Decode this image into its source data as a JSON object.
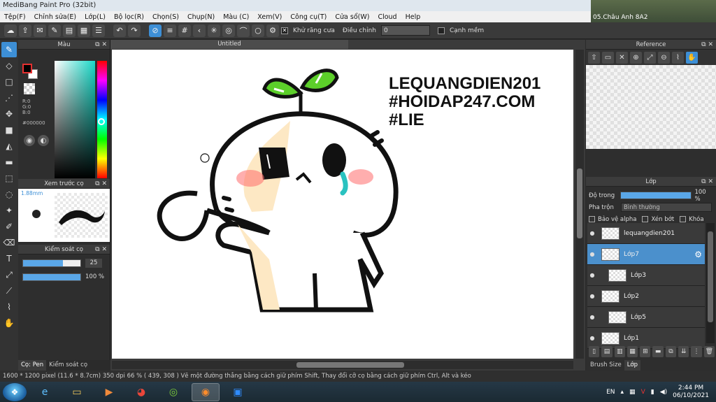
{
  "window": {
    "title": "MediBang Paint Pro (32bit)"
  },
  "desktop": {
    "label": "05.Châu Anh 8A2"
  },
  "menu": [
    {
      "label": "Tệp(F)"
    },
    {
      "label": "Chỉnh sửa(E)"
    },
    {
      "label": "Lớp(L)"
    },
    {
      "label": "Bộ lọc(R)"
    },
    {
      "label": "Chọn(S)"
    },
    {
      "label": "Chụp(N)"
    },
    {
      "label": "Màu (C)"
    },
    {
      "label": "Xem(V)"
    },
    {
      "label": "Công cụ(T)"
    },
    {
      "label": "Cửa sổ(W)"
    },
    {
      "label": "Cloud"
    },
    {
      "label": "Help"
    }
  ],
  "toolbar": {
    "antialias_label": "Khử răng cưa",
    "adjust_label": "Điều chỉnh",
    "adjust_value": "0",
    "edge_label": "Cạnh mềm"
  },
  "color_panel": {
    "title": "Màu",
    "r": "R:0",
    "g": "G:0",
    "b": "B:0",
    "hex": "#000000"
  },
  "brush_preview": {
    "title": "Xem trước cọ",
    "size": "1.88mm"
  },
  "brush_control": {
    "title": "Kiểm soát cọ",
    "size_value": "25",
    "size_fraction": 0.7,
    "opacity_value": "100 %",
    "opacity_fraction": 1.0
  },
  "left_tabs": [
    {
      "label": "Cọ: Pen"
    },
    {
      "label": "Kiểm soát cọ"
    }
  ],
  "canvas": {
    "tab_title": "Untitled",
    "text_line1": "LEQUANGDIEN201",
    "text_line2": "#HOIDAP247.COM",
    "text_line3": "#LIE"
  },
  "reference": {
    "title": "Reference"
  },
  "layers_panel": {
    "title": "Lớp",
    "opacity_label": "Độ trong",
    "opacity_value": "100 %",
    "blend_label": "Pha trộn",
    "blend_value": "Bình thường",
    "protect_alpha": "Bảo vệ alpha",
    "clipping": "Xén bớt",
    "lock": "Khóa",
    "layers": [
      {
        "name": "lequangdien201"
      },
      {
        "name": "Lớp7"
      },
      {
        "name": "Lớp3"
      },
      {
        "name": "Lớp2"
      },
      {
        "name": "Lớp5"
      },
      {
        "name": "Lớp1"
      }
    ]
  },
  "right_tabs": [
    {
      "label": "Brush Size"
    },
    {
      "label": "Lớp"
    }
  ],
  "status": {
    "text": "1600 * 1200 pixel   (11.6 * 8.7cm)   350 dpi   66 %   ( 439, 308 )   Vẽ một đường thẳng bằng cách giữ phím Shift, Thay đổi cỡ cọ bằng cách giữ phím Ctrl, Alt và kéo"
  },
  "taskbar": {
    "lang": "EN",
    "time": "2:44 PM",
    "date": "06/10/2021"
  }
}
